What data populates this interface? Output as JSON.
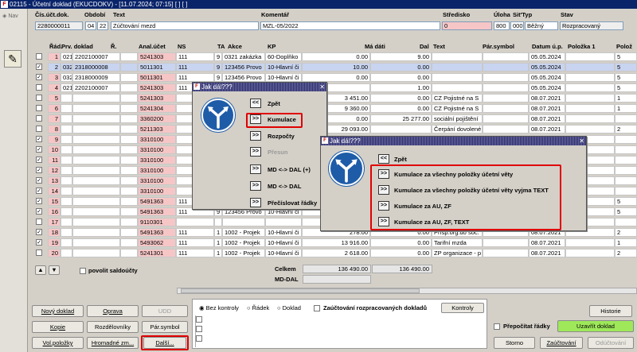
{
  "window": {
    "title": "02115 - Účetní doklad (EKUCDOKV) - [11.07.2024; 07:15]  [ ]  [ ]",
    "logo": "F"
  },
  "nav_label": "Nav",
  "header": {
    "labels": {
      "doc": "Čís.účt.dok.",
      "period": "Období",
      "text": "Text",
      "comment": "Komentář",
      "center": "Středisko",
      "task": "Úloha",
      "type": "Sit'Typ",
      "state": "Stav"
    },
    "doc_number": "2280000011",
    "period_m": "04",
    "period_y": "22",
    "text": "Zúčtování mezd",
    "comment": "MZL-05/2022",
    "center": "0",
    "task": "800",
    "type_code": "000",
    "type_name": "Běžný",
    "state": "Rozpracovaný"
  },
  "columns": [
    "Řád.",
    "Prv. doklad",
    "Ř.",
    "Anal.účet",
    "NS",
    "TA",
    "Akce",
    "KP",
    "Má dáti",
    "Dal",
    "Text",
    "Pár.symbol",
    "Datum ú.p.",
    "Položka 1",
    "Polož"
  ],
  "rows": [
    {
      "r": "1",
      "t": "021",
      "doc": "2202100007",
      "acc": "5241303",
      "ns": "111",
      "ta": "9",
      "akce": "0321 zakázka",
      "kp": "60-Doplňko",
      "md": "0.00",
      "dal": "9.00",
      "text": "",
      "par": "",
      "date": "05.05.2024",
      "p1": "",
      "p2": "5",
      "chk": false
    },
    {
      "r": "2",
      "t": "032",
      "doc": "2318000008",
      "acc": "5011301",
      "ns": "111",
      "ta": "9",
      "akce": "123456 Provo",
      "kp": "10-Hlavní či",
      "md": "10.00",
      "dal": "0.00",
      "text": "",
      "par": "",
      "date": "05.05.2024",
      "p1": "",
      "p2": "5",
      "chk": true
    },
    {
      "r": "3",
      "t": "032",
      "doc": "2318000009",
      "acc": "5011301",
      "ns": "111",
      "ta": "9",
      "akce": "123456 Provo",
      "kp": "10-Hlavní či",
      "md": "0.00",
      "dal": "0.00",
      "text": "",
      "par": "",
      "date": "05.05.2024",
      "p1": "",
      "p2": "5",
      "chk": true
    },
    {
      "r": "4",
      "t": "021",
      "doc": "2202100007",
      "acc": "5241303",
      "ns": "111",
      "ta": "",
      "akce": "",
      "kp": "",
      "md": "",
      "dal": "1.00",
      "text": "",
      "par": "",
      "date": "05.05.2024",
      "p1": "",
      "p2": "5",
      "chk": false
    },
    {
      "r": "5",
      "t": "",
      "doc": "",
      "acc": "5241303",
      "ns": "",
      "ta": "",
      "akce": "",
      "kp": "",
      "md": "3 451.00",
      "dal": "0.00",
      "text": "CZ Pojistné na S",
      "par": "",
      "date": "08.07.2021",
      "p1": "",
      "p2": "1",
      "chk": false
    },
    {
      "r": "6",
      "t": "",
      "doc": "",
      "acc": "5241304",
      "ns": "",
      "ta": "",
      "akce": "",
      "kp": "",
      "md": "9 360.00",
      "dal": "0.00",
      "text": "CZ Pojistné na S",
      "par": "",
      "date": "08.07.2021",
      "p1": "",
      "p2": "1",
      "chk": false
    },
    {
      "r": "7",
      "t": "",
      "doc": "",
      "acc": "3360200",
      "ns": "",
      "ta": "",
      "akce": "",
      "kp": "",
      "md": "0.00",
      "dal": "25 277.00",
      "text": "sociální pojištění",
      "par": "",
      "date": "08.07.2021",
      "p1": "",
      "p2": "",
      "chk": false
    },
    {
      "r": "8",
      "t": "",
      "doc": "",
      "acc": "5211303",
      "ns": "",
      "ta": "",
      "akce": "",
      "kp": "",
      "md": "29 093.00",
      "dal": "",
      "text": "Čerpání dovolené",
      "par": "",
      "date": "08.07.2021",
      "p1": "",
      "p2": "2",
      "chk": false
    },
    {
      "r": "9",
      "t": "",
      "doc": "",
      "acc": "3310100",
      "ns": "",
      "ta": "",
      "akce": "",
      "kp": "",
      "md": "",
      "dal": "",
      "text": "",
      "par": "",
      "date": "",
      "p1": "",
      "p2": "",
      "chk": true
    },
    {
      "r": "10",
      "t": "",
      "doc": "",
      "acc": "3310100",
      "ns": "",
      "ta": "",
      "akce": "",
      "kp": "",
      "md": "",
      "dal": "",
      "text": "",
      "par": "",
      "date": "",
      "p1": "",
      "p2": "",
      "chk": true
    },
    {
      "r": "11",
      "t": "",
      "doc": "",
      "acc": "3310100",
      "ns": "",
      "ta": "",
      "akce": "",
      "kp": "",
      "md": "",
      "dal": "",
      "text": "",
      "par": "",
      "date": "",
      "p1": "",
      "p2": "",
      "chk": true
    },
    {
      "r": "12",
      "t": "",
      "doc": "",
      "acc": "3310100",
      "ns": "",
      "ta": "",
      "akce": "",
      "kp": "",
      "md": "",
      "dal": "",
      "text": "",
      "par": "",
      "date": "",
      "p1": "",
      "p2": "",
      "chk": true
    },
    {
      "r": "13",
      "t": "",
      "doc": "",
      "acc": "3310100",
      "ns": "",
      "ta": "",
      "akce": "",
      "kp": "",
      "md": "",
      "dal": "",
      "text": "",
      "par": "",
      "date": "",
      "p1": "",
      "p2": "",
      "chk": true
    },
    {
      "r": "14",
      "t": "",
      "doc": "",
      "acc": "3310100",
      "ns": "",
      "ta": "",
      "akce": "",
      "kp": "",
      "md": "",
      "dal": "",
      "text": "",
      "par": "",
      "date": "",
      "p1": "",
      "p2": "",
      "chk": true
    },
    {
      "r": "15",
      "t": "",
      "doc": "",
      "acc": "5491363",
      "ns": "111",
      "ta": "",
      "akce": "",
      "kp": "",
      "md": "",
      "dal": "",
      "text": "",
      "par": "",
      "date": "",
      "p1": "",
      "p2": "5",
      "chk": true
    },
    {
      "r": "16",
      "t": "",
      "doc": "",
      "acc": "5491363",
      "ns": "111",
      "ta": "9",
      "akce": "123456 Provo",
      "kp": "10-Hlavní či",
      "md": "",
      "dal": "",
      "text": "",
      "par": "",
      "date": "",
      "p1": "",
      "p2": "5",
      "chk": true
    },
    {
      "r": "17",
      "t": "",
      "doc": "",
      "acc": "9110301",
      "ns": "",
      "ta": "",
      "akce": "",
      "kp": "",
      "md": "",
      "dal": "",
      "text": "",
      "par": "",
      "date": "",
      "p1": "",
      "p2": "",
      "chk": false
    },
    {
      "r": "18",
      "t": "",
      "doc": "",
      "acc": "5491363",
      "ns": "111",
      "ta": "1",
      "akce": "1002 - Projek",
      "kp": "10-Hlavní či",
      "md": "278.00",
      "dal": "0.00",
      "text": "Přísp.org.do soc.",
      "par": "",
      "date": "08.07.2021",
      "p1": "",
      "p2": "2",
      "chk": true
    },
    {
      "r": "19",
      "t": "",
      "doc": "",
      "acc": "5493062",
      "ns": "111",
      "ta": "1",
      "akce": "1002 - Projek",
      "kp": "10-Hlavní či",
      "md": "13 916.00",
      "dal": "0.00",
      "text": "Tarifní mzda",
      "par": "",
      "date": "08.07.2021",
      "p1": "",
      "p2": "1",
      "chk": true
    },
    {
      "r": "20",
      "t": "",
      "doc": "",
      "acc": "5241301",
      "ns": "111",
      "ta": "1",
      "akce": "1002 - Projek",
      "kp": "10-Hlavní či",
      "md": "2 618.00",
      "dal": "0.00",
      "text": "ZP organizace - p",
      "par": "",
      "date": "08.07.2021",
      "p1": "",
      "p2": "2",
      "chk": false
    }
  ],
  "below_grid": {
    "saldo_label": "povolit saldoúčty",
    "celkem_label": "Celkem",
    "mddal_label": "MD-DAL",
    "total_md": "136 490.00",
    "total_dal": "136 490.00"
  },
  "dialog1": {
    "title": "Jak dál???",
    "items": [
      {
        "btn": "<<",
        "label": "Zpět",
        "disabled": false
      },
      {
        "btn": ">>",
        "label": "Kumulace",
        "disabled": false
      },
      {
        "btn": ">>",
        "label": "Rozpočty",
        "disabled": false
      },
      {
        "btn": ">>",
        "label": "Přesun",
        "disabled": true
      },
      {
        "btn": ">>",
        "label": "MD <-> DAL (+)",
        "disabled": false
      },
      {
        "btn": ">>",
        "label": "MD <-> DAL",
        "disabled": false
      },
      {
        "btn": ">>",
        "label": "Přečíslovat řádky",
        "disabled": false
      }
    ]
  },
  "dialog2": {
    "title": "Jak dál???",
    "items": [
      {
        "btn": "<<",
        "label": "Zpět"
      },
      {
        "btn": ">>",
        "label": "Kumulace za všechny položky účetní věty"
      },
      {
        "btn": ">>",
        "label": "Kumulace za všechny položky účetní věty vyjma TEXT"
      },
      {
        "btn": ">>",
        "label": "Kumulace za AU, ZF"
      },
      {
        "btn": ">>",
        "label": "Kumulace za AU, ZF, TEXT"
      }
    ]
  },
  "buttons": {
    "new_doc": "Nový doklad",
    "edit": "Oprava",
    "udd": "UDD",
    "copy": "Kopie",
    "breakdowns": "Rozdělovníky",
    "pair_symbol": "Pár.symbol",
    "vol_items": "Vol.položky",
    "bulk_edit": "Hromadné zm...",
    "next": "Další...",
    "history": "Historie",
    "close_doc": "Uzavřít doklad",
    "cancel": "Storno",
    "post": "Zaúčtování",
    "unpost": "Odúčtování"
  },
  "options": {
    "no_control": "Bez kontroly",
    "row": "Řádek",
    "document": "Doklad",
    "post_processed": "Zaúčtování rozpracovaných dokladů",
    "controls": "Kontroly",
    "recalc_rows": "Přepočítat řádky"
  }
}
